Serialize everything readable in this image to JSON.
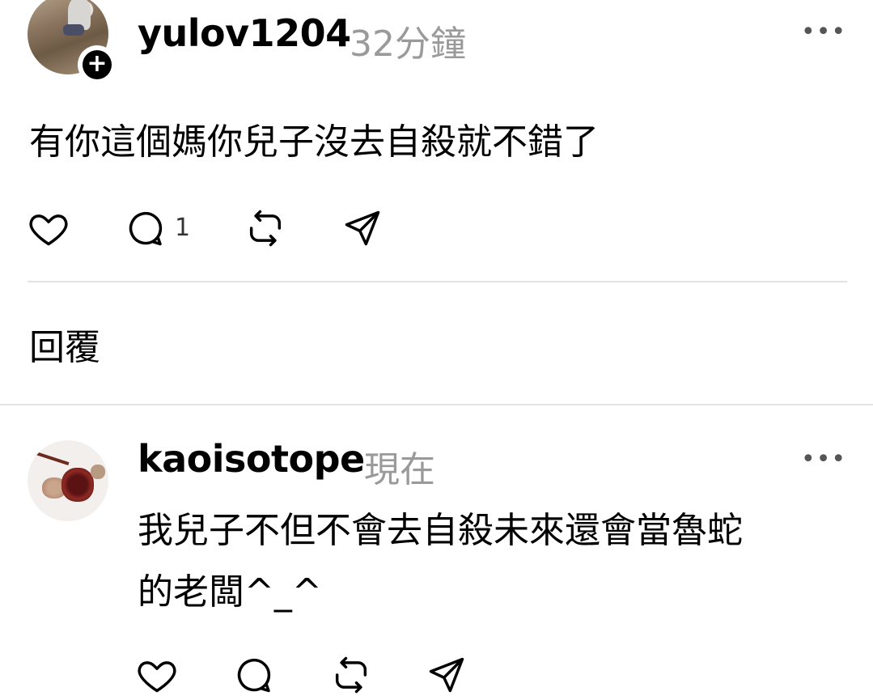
{
  "post": {
    "username": "yulov1204",
    "time": "32分鐘",
    "text": "有你這個媽你兒子沒去自殺就不錯了",
    "reply_count": "1",
    "icons": [
      "heart-icon",
      "comment-icon",
      "repost-icon",
      "share-icon"
    ]
  },
  "reply_header": "回覆",
  "reply": {
    "username": "kaoisotope",
    "time": "現在",
    "text_line1": "我兒子不但不會去自殺未來還會當魯蛇",
    "text_line2": "的老闆^_^"
  },
  "more_icon": "more-icon"
}
